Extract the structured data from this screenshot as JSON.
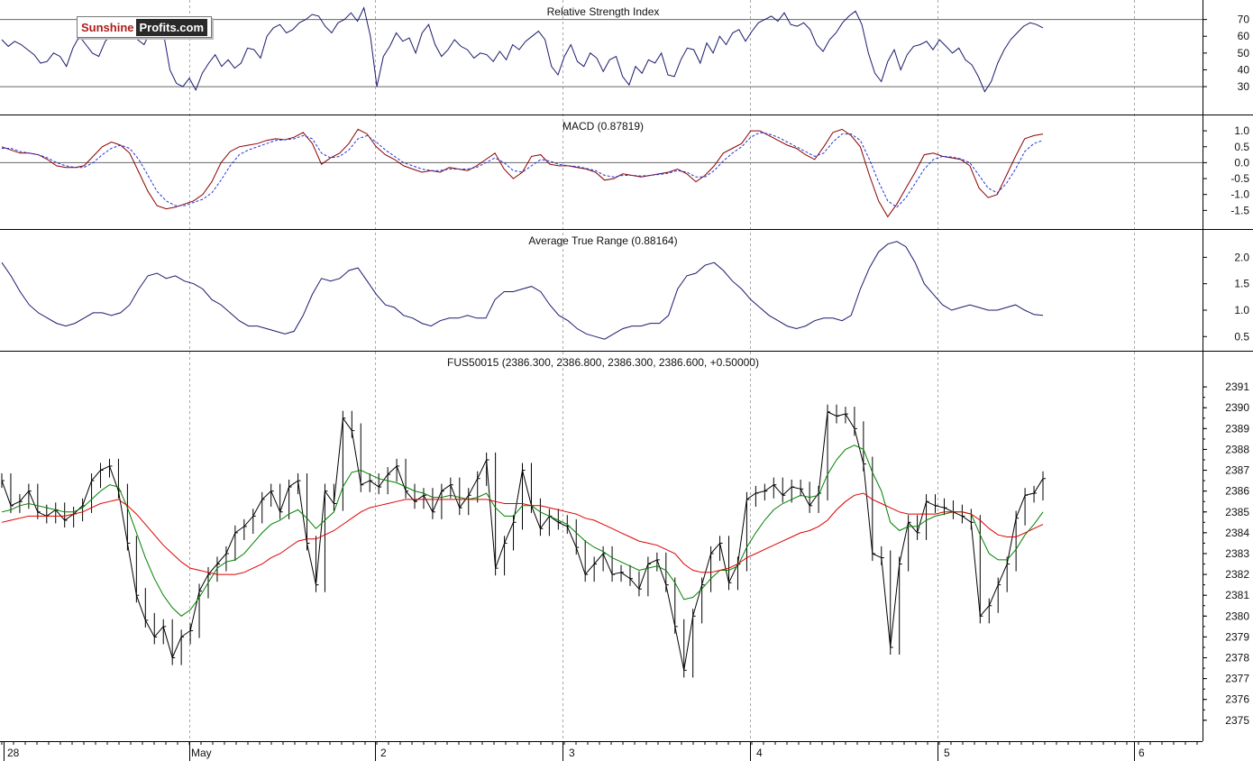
{
  "logo": {
    "part1": "Sunshine",
    "part2": "Profits.com"
  },
  "x_labels": [
    "28",
    "May",
    "2",
    "3",
    "4",
    "5",
    "6"
  ],
  "colors": {
    "line": "#1a1a6e",
    "macd": "#8b0000",
    "signal": "#2233dd",
    "price": "#000000",
    "ma_fast": "#008000",
    "ma_slow": "#dd0000",
    "grid": "#aaaaaa"
  },
  "chart_data": [
    {
      "type": "line",
      "title": "Relative Strength Index",
      "ylim": [
        15,
        80
      ],
      "ticks": [
        30,
        40,
        50,
        60,
        70
      ],
      "reference_lines": [
        30,
        70
      ],
      "series": [
        {
          "values": [
            58,
            54,
            57,
            55,
            52,
            49,
            44,
            45,
            50,
            48,
            42,
            53,
            60,
            55,
            50,
            48,
            57,
            61,
            64,
            66,
            62,
            58,
            55,
            63,
            65,
            62,
            40,
            32,
            30,
            35,
            28,
            38,
            44,
            49,
            42,
            46,
            41,
            44,
            53,
            52,
            47,
            60,
            65,
            67,
            62,
            64,
            68,
            70,
            73,
            72,
            66,
            62,
            68,
            70,
            74,
            69,
            77,
            60,
            30,
            48,
            54,
            62,
            57,
            59,
            50,
            62,
            67,
            55,
            48,
            52,
            58,
            54,
            52,
            47,
            50,
            49,
            45,
            51,
            46,
            55,
            52,
            57,
            60,
            63,
            58,
            42,
            37,
            48,
            55,
            45,
            42,
            50,
            47,
            39,
            46,
            48,
            36,
            31,
            42,
            38,
            46,
            44,
            50,
            37,
            36,
            46,
            53,
            52,
            44,
            56,
            50,
            60,
            55,
            62,
            64,
            57,
            63,
            68,
            70,
            72,
            69,
            74,
            67,
            66,
            68,
            64,
            55,
            51,
            58,
            62,
            68,
            72,
            75,
            67,
            50,
            38,
            33,
            45,
            52,
            40,
            49,
            54,
            55,
            57,
            52,
            58,
            54,
            50,
            53,
            46,
            43,
            36,
            27,
            33,
            44,
            52,
            58,
            62,
            66,
            68,
            67,
            65
          ]
        }
      ]
    },
    {
      "type": "line",
      "title": "MACD (0.87819)",
      "ylim": [
        -2.0,
        1.4
      ],
      "ticks": [
        1.0,
        0.5,
        0.0,
        -0.5,
        -1.0,
        -1.5
      ],
      "reference_lines": [
        0.0
      ],
      "series": [
        {
          "values": [
            0.5,
            0.4,
            0.3,
            0.3,
            0.25,
            0.1,
            -0.1,
            -0.15,
            -0.15,
            -0.1,
            0.2,
            0.5,
            0.65,
            0.55,
            0.3,
            -0.3,
            -0.9,
            -1.35,
            -1.45,
            -1.4,
            -1.3,
            -1.2,
            -1.0,
            -0.6,
            0.0,
            0.35,
            0.5,
            0.55,
            0.6,
            0.7,
            0.75,
            0.72,
            0.8,
            0.95,
            0.6,
            -0.05,
            0.15,
            0.3,
            0.6,
            1.05,
            0.9,
            0.5,
            0.25,
            0.1,
            -0.1,
            -0.2,
            -0.3,
            -0.25,
            -0.3,
            -0.15,
            -0.2,
            -0.25,
            -0.1,
            0.1,
            0.3,
            -0.2,
            -0.5,
            -0.3,
            0.2,
            0.25,
            -0.05,
            -0.1,
            -0.1,
            -0.15,
            -0.2,
            -0.3,
            -0.55,
            -0.5,
            -0.35,
            -0.4,
            -0.45,
            -0.4,
            -0.35,
            -0.3,
            -0.2,
            -0.35,
            -0.6,
            -0.4,
            -0.1,
            0.3,
            0.45,
            0.6,
            1.0,
            1.0,
            0.85,
            0.7,
            0.55,
            0.45,
            0.25,
            0.1,
            0.5,
            0.95,
            1.05,
            0.85,
            0.5,
            -0.4,
            -1.2,
            -1.7,
            -1.3,
            -0.8,
            -0.3,
            0.25,
            0.3,
            0.2,
            0.15,
            0.1,
            -0.1,
            -0.8,
            -1.1,
            -1.0,
            -0.4,
            0.2,
            0.75,
            0.85,
            0.9
          ]
        },
        {
          "values": [
            0.45,
            0.45,
            0.35,
            0.3,
            0.25,
            0.15,
            0.0,
            -0.1,
            -0.15,
            -0.15,
            0.0,
            0.25,
            0.45,
            0.55,
            0.45,
            0.1,
            -0.4,
            -0.9,
            -1.2,
            -1.35,
            -1.35,
            -1.25,
            -1.15,
            -0.95,
            -0.55,
            -0.1,
            0.25,
            0.4,
            0.5,
            0.6,
            0.7,
            0.72,
            0.75,
            0.85,
            0.75,
            0.3,
            0.15,
            0.2,
            0.4,
            0.75,
            0.85,
            0.65,
            0.4,
            0.2,
            0.0,
            -0.1,
            -0.2,
            -0.25,
            -0.25,
            -0.2,
            -0.2,
            -0.2,
            -0.15,
            0.0,
            0.15,
            0.0,
            -0.25,
            -0.3,
            -0.1,
            0.1,
            0.05,
            -0.05,
            -0.1,
            -0.12,
            -0.18,
            -0.25,
            -0.4,
            -0.45,
            -0.4,
            -0.4,
            -0.42,
            -0.4,
            -0.37,
            -0.33,
            -0.25,
            -0.3,
            -0.45,
            -0.45,
            -0.25,
            0.05,
            0.3,
            0.5,
            0.8,
            0.95,
            0.9,
            0.8,
            0.65,
            0.5,
            0.35,
            0.2,
            0.3,
            0.65,
            0.9,
            0.9,
            0.7,
            0.1,
            -0.6,
            -1.2,
            -1.4,
            -1.1,
            -0.65,
            -0.2,
            0.1,
            0.2,
            0.18,
            0.12,
            0.0,
            -0.4,
            -0.8,
            -0.95,
            -0.65,
            -0.2,
            0.35,
            0.6,
            0.7
          ]
        }
      ]
    },
    {
      "type": "line",
      "title": "Average True Range (0.88164)",
      "ylim": [
        0.3,
        2.45
      ],
      "ticks": [
        2.0,
        1.5,
        1.0,
        0.5
      ],
      "series": [
        {
          "values": [
            1.9,
            1.65,
            1.35,
            1.1,
            0.95,
            0.85,
            0.75,
            0.7,
            0.75,
            0.85,
            0.95,
            0.95,
            0.9,
            0.95,
            1.1,
            1.4,
            1.65,
            1.7,
            1.6,
            1.65,
            1.55,
            1.5,
            1.4,
            1.2,
            1.1,
            0.95,
            0.8,
            0.7,
            0.7,
            0.65,
            0.6,
            0.55,
            0.6,
            0.9,
            1.3,
            1.6,
            1.55,
            1.6,
            1.75,
            1.8,
            1.55,
            1.3,
            1.1,
            1.05,
            0.9,
            0.85,
            0.75,
            0.7,
            0.8,
            0.85,
            0.85,
            0.9,
            0.85,
            0.85,
            1.2,
            1.35,
            1.35,
            1.4,
            1.45,
            1.35,
            1.1,
            0.9,
            0.8,
            0.65,
            0.55,
            0.5,
            0.45,
            0.55,
            0.65,
            0.7,
            0.7,
            0.75,
            0.75,
            0.9,
            1.4,
            1.65,
            1.7,
            1.85,
            1.9,
            1.75,
            1.55,
            1.4,
            1.2,
            1.05,
            0.9,
            0.8,
            0.7,
            0.65,
            0.7,
            0.8,
            0.85,
            0.85,
            0.8,
            0.9,
            1.4,
            1.8,
            2.1,
            2.25,
            2.3,
            2.2,
            1.9,
            1.5,
            1.3,
            1.1,
            1.0,
            1.05,
            1.1,
            1.05,
            1.0,
            1.0,
            1.05,
            1.1,
            1.0,
            0.92,
            0.9
          ]
        }
      ]
    },
    {
      "type": "line",
      "title": "FUS50015 (2386.300, 2386.800, 2386.300, 2386.600, +0.50000)",
      "ylim": [
        2374.3,
        2392.0
      ],
      "ticks": [
        2391,
        2390,
        2389,
        2388,
        2387,
        2386,
        2385,
        2384,
        2383,
        2382,
        2381,
        2380,
        2379,
        2378,
        2377,
        2376,
        2375
      ],
      "series": [
        {
          "values": [
            2386.5,
            2385.3,
            2385.5,
            2386.0,
            2385.0,
            2384.8,
            2385.1,
            2384.6,
            2384.9,
            2385.3,
            2386.5,
            2387.0,
            2387.2,
            2386.0,
            2383.5,
            2381.0,
            2379.8,
            2379.0,
            2379.5,
            2378.0,
            2379.0,
            2379.3,
            2381.2,
            2382.0,
            2382.5,
            2383.0,
            2384.0,
            2384.3,
            2384.8,
            2385.6,
            2386.0,
            2385.0,
            2386.2,
            2386.5,
            2383.5,
            2381.5,
            2386.0,
            2385.4,
            2389.5,
            2388.9,
            2386.3,
            2386.5,
            2386.2,
            2386.8,
            2387.2,
            2386.0,
            2385.5,
            2385.8,
            2385.0,
            2386.0,
            2386.3,
            2385.2,
            2385.8,
            2386.6,
            2387.5,
            2382.3,
            2383.5,
            2384.5,
            2387.0,
            2385.3,
            2384.2,
            2384.8,
            2384.5,
            2384.3,
            2383.3,
            2382.0,
            2382.5,
            2383.0,
            2382.0,
            2382.1,
            2381.8,
            2381.3,
            2382.5,
            2382.7,
            2381.5,
            2379.5,
            2377.4,
            2380.0,
            2381.5,
            2383.0,
            2383.5,
            2381.6,
            2382.5,
            2385.6,
            2385.9,
            2386.0,
            2386.3,
            2385.8,
            2386.2,
            2386.1,
            2385.3,
            2385.9,
            2389.8,
            2389.6,
            2389.7,
            2389.0,
            2387.3,
            2383.0,
            2382.8,
            2378.5,
            2382.5,
            2384.5,
            2384.0,
            2385.5,
            2385.3,
            2385.2,
            2385.0,
            2384.8,
            2384.5,
            2380.0,
            2380.5,
            2381.5,
            2382.5,
            2384.7,
            2385.8,
            2385.9,
            2386.6
          ]
        },
        {
          "values": [
            2385.0,
            2385.1,
            2385.3,
            2385.4,
            2385.3,
            2385.2,
            2385.1,
            2385.0,
            2385.0,
            2385.2,
            2385.6,
            2386.0,
            2386.3,
            2386.2,
            2385.2,
            2384.0,
            2382.8,
            2381.8,
            2381.0,
            2380.4,
            2380.0,
            2380.3,
            2380.9,
            2381.6,
            2382.3,
            2382.6,
            2382.7,
            2383.0,
            2383.5,
            2384.0,
            2384.4,
            2384.6,
            2384.9,
            2385.1,
            2384.7,
            2384.2,
            2384.6,
            2385.0,
            2386.2,
            2386.9,
            2387.0,
            2386.8,
            2386.6,
            2386.5,
            2386.4,
            2386.2,
            2386.0,
            2385.9,
            2385.7,
            2385.7,
            2385.8,
            2385.7,
            2385.6,
            2385.7,
            2385.9,
            2385.2,
            2384.8,
            2384.8,
            2385.3,
            2385.3,
            2385.0,
            2384.8,
            2384.6,
            2384.4,
            2384.0,
            2383.6,
            2383.3,
            2383.1,
            2382.8,
            2382.6,
            2382.4,
            2382.2,
            2382.3,
            2382.4,
            2382.2,
            2381.6,
            2380.8,
            2380.9,
            2381.3,
            2381.8,
            2382.2,
            2382.2,
            2382.4,
            2383.3,
            2384.0,
            2384.6,
            2385.1,
            2385.4,
            2385.6,
            2385.8,
            2385.7,
            2385.8,
            2386.8,
            2387.5,
            2388.0,
            2388.2,
            2388.0,
            2386.9,
            2386.0,
            2384.5,
            2384.1,
            2384.3,
            2384.3,
            2384.6,
            2384.8,
            2384.9,
            2385.0,
            2385.0,
            2384.9,
            2383.9,
            2383.0,
            2382.7,
            2382.7,
            2383.2,
            2383.9,
            2384.4,
            2385.0
          ]
        },
        {
          "values": [
            2384.5,
            2384.6,
            2384.7,
            2384.8,
            2384.8,
            2384.8,
            2384.8,
            2384.8,
            2384.9,
            2385.0,
            2385.2,
            2385.4,
            2385.5,
            2385.6,
            2385.3,
            2384.9,
            2384.4,
            2383.9,
            2383.4,
            2383.0,
            2382.6,
            2382.3,
            2382.2,
            2382.1,
            2382.0,
            2382.0,
            2382.0,
            2382.1,
            2382.3,
            2382.5,
            2382.8,
            2383.0,
            2383.3,
            2383.6,
            2383.7,
            2383.7,
            2383.9,
            2384.1,
            2384.4,
            2384.7,
            2385.0,
            2385.2,
            2385.3,
            2385.4,
            2385.5,
            2385.6,
            2385.6,
            2385.6,
            2385.6,
            2385.6,
            2385.6,
            2385.6,
            2385.6,
            2385.6,
            2385.6,
            2385.5,
            2385.4,
            2385.4,
            2385.4,
            2385.3,
            2385.3,
            2385.2,
            2385.1,
            2385.0,
            2384.9,
            2384.7,
            2384.6,
            2384.4,
            2384.2,
            2384.0,
            2383.8,
            2383.6,
            2383.5,
            2383.4,
            2383.2,
            2383.0,
            2382.5,
            2382.2,
            2382.1,
            2382.1,
            2382.2,
            2382.3,
            2382.5,
            2382.8,
            2383.0,
            2383.2,
            2383.4,
            2383.6,
            2383.8,
            2384.0,
            2384.1,
            2384.3,
            2384.6,
            2385.1,
            2385.5,
            2385.8,
            2385.9,
            2385.6,
            2385.4,
            2385.2,
            2385.0,
            2384.9,
            2384.9,
            2384.9,
            2384.9,
            2385.0,
            2385.0,
            2385.0,
            2384.9,
            2384.6,
            2384.2,
            2383.9,
            2383.8,
            2383.8,
            2384.0,
            2384.2,
            2384.4
          ]
        }
      ]
    }
  ]
}
